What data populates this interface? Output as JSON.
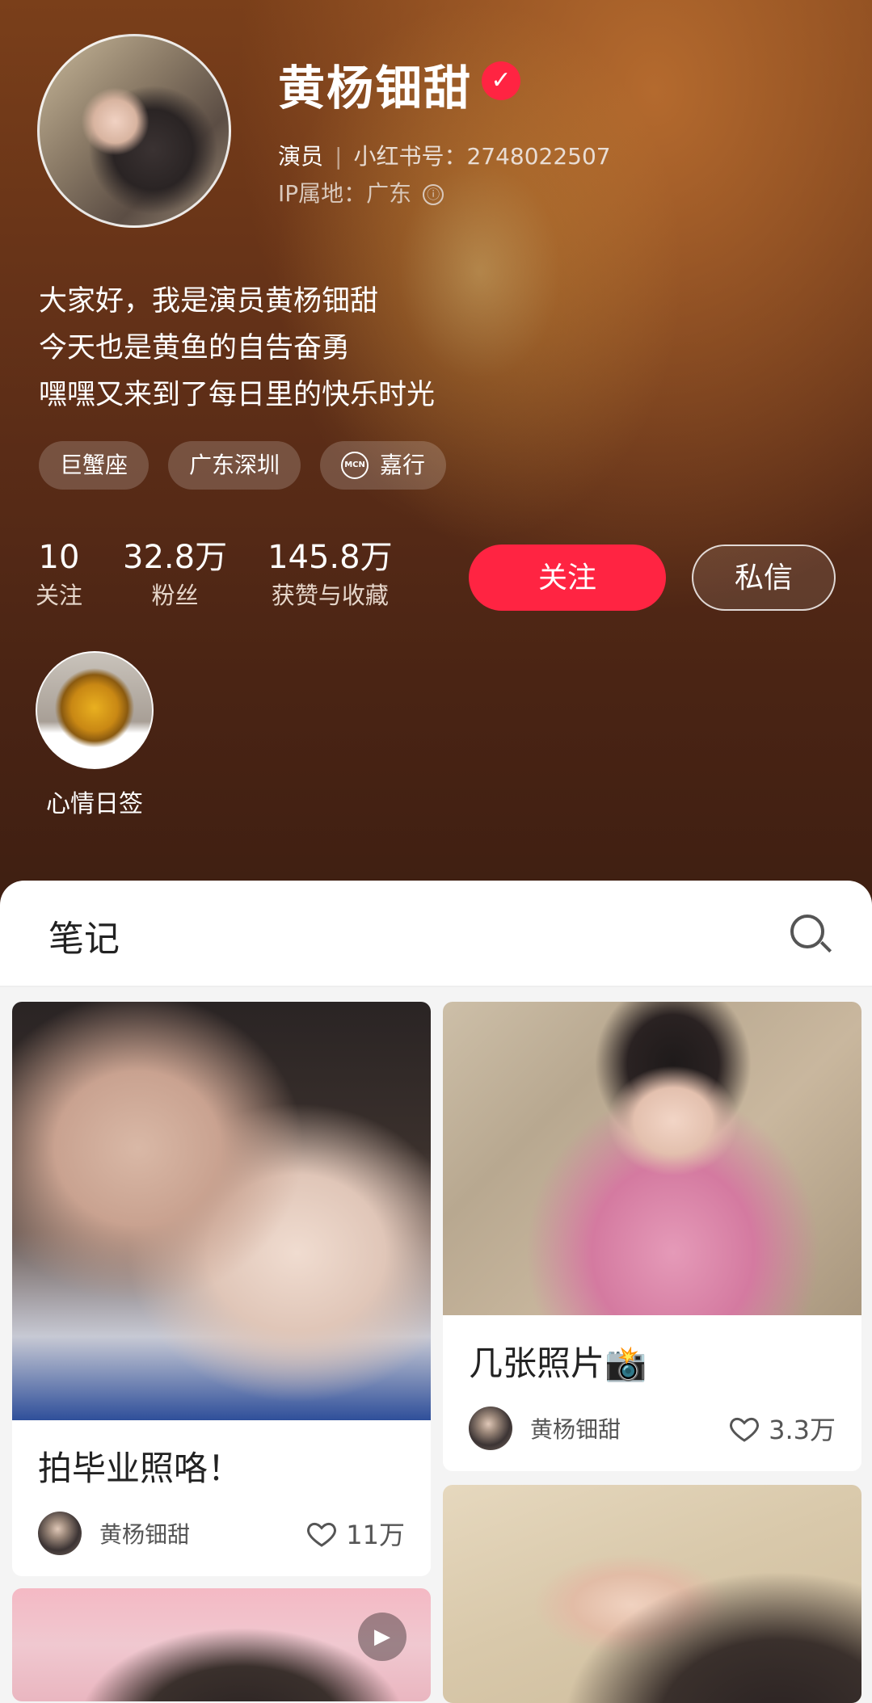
{
  "profile": {
    "name": "黄杨钿甜",
    "role": "演员",
    "id_label": "小红书号：2748022507",
    "ip_label": "IP属地：广东",
    "info_icon": "ⓘ",
    "verified_icon": "✓"
  },
  "bio": {
    "line1": "大家好，我是演员黄杨钿甜",
    "line2": "今天也是黄鱼的自告奋勇",
    "line3": "嘿嘿又来到了每日里的快乐时光"
  },
  "tags": [
    "巨蟹座",
    "广东深圳",
    "嘉行"
  ],
  "mcn_badge": "MCN",
  "stats": [
    {
      "num": "10",
      "label": "关注"
    },
    {
      "num": "32.8万",
      "label": "粉丝"
    },
    {
      "num": "145.8万",
      "label": "获赞与收藏"
    }
  ],
  "buttons": {
    "follow": "关注",
    "message": "私信"
  },
  "collection": {
    "label": "心情日签"
  },
  "panel": {
    "tab": "笔记"
  },
  "cards": [
    {
      "title": "拍毕业照咯！",
      "author": "黄杨钿甜",
      "likes": "11万"
    },
    {
      "title": "几张照片📸",
      "author": "黄杨钿甜",
      "likes": "3.3万"
    }
  ],
  "colors": {
    "accent": "#ff2442",
    "header_bg": "#5a2c17"
  }
}
